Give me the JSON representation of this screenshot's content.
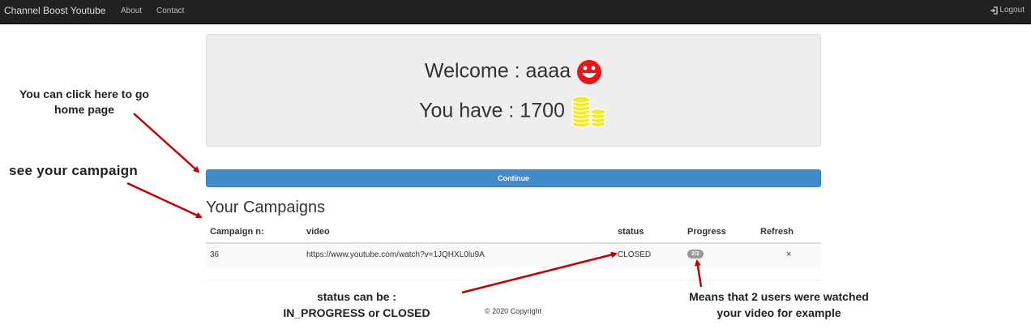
{
  "navbar": {
    "brand": "Channel Boost Youtube",
    "links": [
      "About",
      "Contact"
    ],
    "logout": "Logout"
  },
  "welcome": {
    "label": "Welcome : aaaa",
    "coins_label": "You have : 1700"
  },
  "continue_button": "Continue",
  "campaigns": {
    "title": "Your Campaigns",
    "columns": [
      "Campaign n:",
      "video",
      "status",
      "Progress",
      "Refresh"
    ],
    "rows": [
      {
        "id": "36",
        "video": "https://www.youtube.com/watch?v=1JQHXL0lu9A",
        "status": "CLOSED",
        "progress": "2/2",
        "refresh": "×"
      }
    ]
  },
  "footer": "© 2020 Copyright",
  "annotations": {
    "home": "You can click here to go home page",
    "campaign": "see your campaign",
    "status_line1": "status can be :",
    "status_line2": "IN_PROGRESS or CLOSED",
    "progress_line1": "Means that 2 users were watched",
    "progress_line2": "your video for example"
  },
  "colors": {
    "navbar": "#222222",
    "button": "#428bca",
    "smiley": "#e8161b",
    "coins": "#f2ea2a",
    "arrow": "#c00000"
  },
  "icons": [
    "logout-icon",
    "smiley-icon",
    "coins-icon"
  ]
}
